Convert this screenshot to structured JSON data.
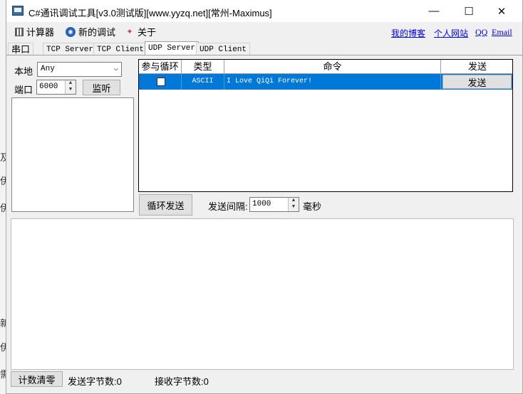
{
  "window": {
    "title": "C#通讯调试工具[v3.0测试版][www.yyzq.net][常州-Maximus]",
    "controls": {
      "minimize": "—",
      "maximize": "☐",
      "close": "✕"
    }
  },
  "menu": {
    "items": [
      {
        "label": "计算器",
        "icon": "calculator-icon"
      },
      {
        "label": "新的调试",
        "icon": "globe-icon"
      },
      {
        "label": "关于",
        "icon": "about-icon"
      }
    ],
    "links": [
      "我的博客",
      "个人网站",
      "QQ",
      "Email"
    ]
  },
  "tabs": [
    "串口",
    "TCP Server",
    "TCP Client",
    "UDP Server",
    "UDP Client"
  ],
  "active_tab": "UDP Server",
  "local": {
    "label": "本地",
    "value": "Any",
    "port_label": "端口",
    "port_value": "6000",
    "listen_label": "监听"
  },
  "table": {
    "headers": [
      "参与循环",
      "类型",
      "命令",
      "发送"
    ],
    "rows": [
      {
        "checked": false,
        "type": "ASCII",
        "command": "I Love QiQi Forever!",
        "send_label": "发送"
      }
    ]
  },
  "loop": {
    "button_label": "循环发送",
    "interval_label": "发送间隔:",
    "interval_value": "1000",
    "unit": "毫秒"
  },
  "status": {
    "clear_label": "计数清零",
    "sent_label": "发送字节数:0",
    "recv_label": "接收字节数:0"
  },
  "background_letters": [
    "及",
    "伊",
    "伊",
    "新",
    "伊",
    "需"
  ],
  "colors": {
    "selection": "#0078d7",
    "link": "#0000ee"
  }
}
